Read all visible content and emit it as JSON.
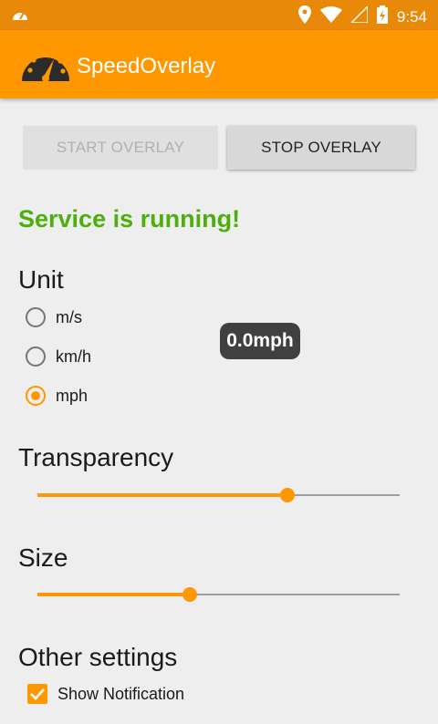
{
  "status_bar": {
    "time": "9:54"
  },
  "app_bar": {
    "title": "SpeedOverlay"
  },
  "controls": {
    "start_label": "START OVERLAY",
    "stop_label": "STOP OVERLAY"
  },
  "service_status": "Service is running!",
  "unit": {
    "heading": "Unit",
    "options": [
      {
        "label": "m/s",
        "checked": false
      },
      {
        "label": "km/h",
        "checked": false
      },
      {
        "label": "mph",
        "checked": true
      }
    ]
  },
  "overlay_preview": "0.0mph",
  "transparency": {
    "heading": "Transparency",
    "value": 0.69
  },
  "size": {
    "heading": "Size",
    "value": 0.42
  },
  "other": {
    "heading": "Other settings",
    "show_notification_label": "Show Notification",
    "show_notification_checked": true
  },
  "colors": {
    "accent": "#ff9800",
    "status_ok": "#4caf0c",
    "status_bar": "#e8890a"
  }
}
